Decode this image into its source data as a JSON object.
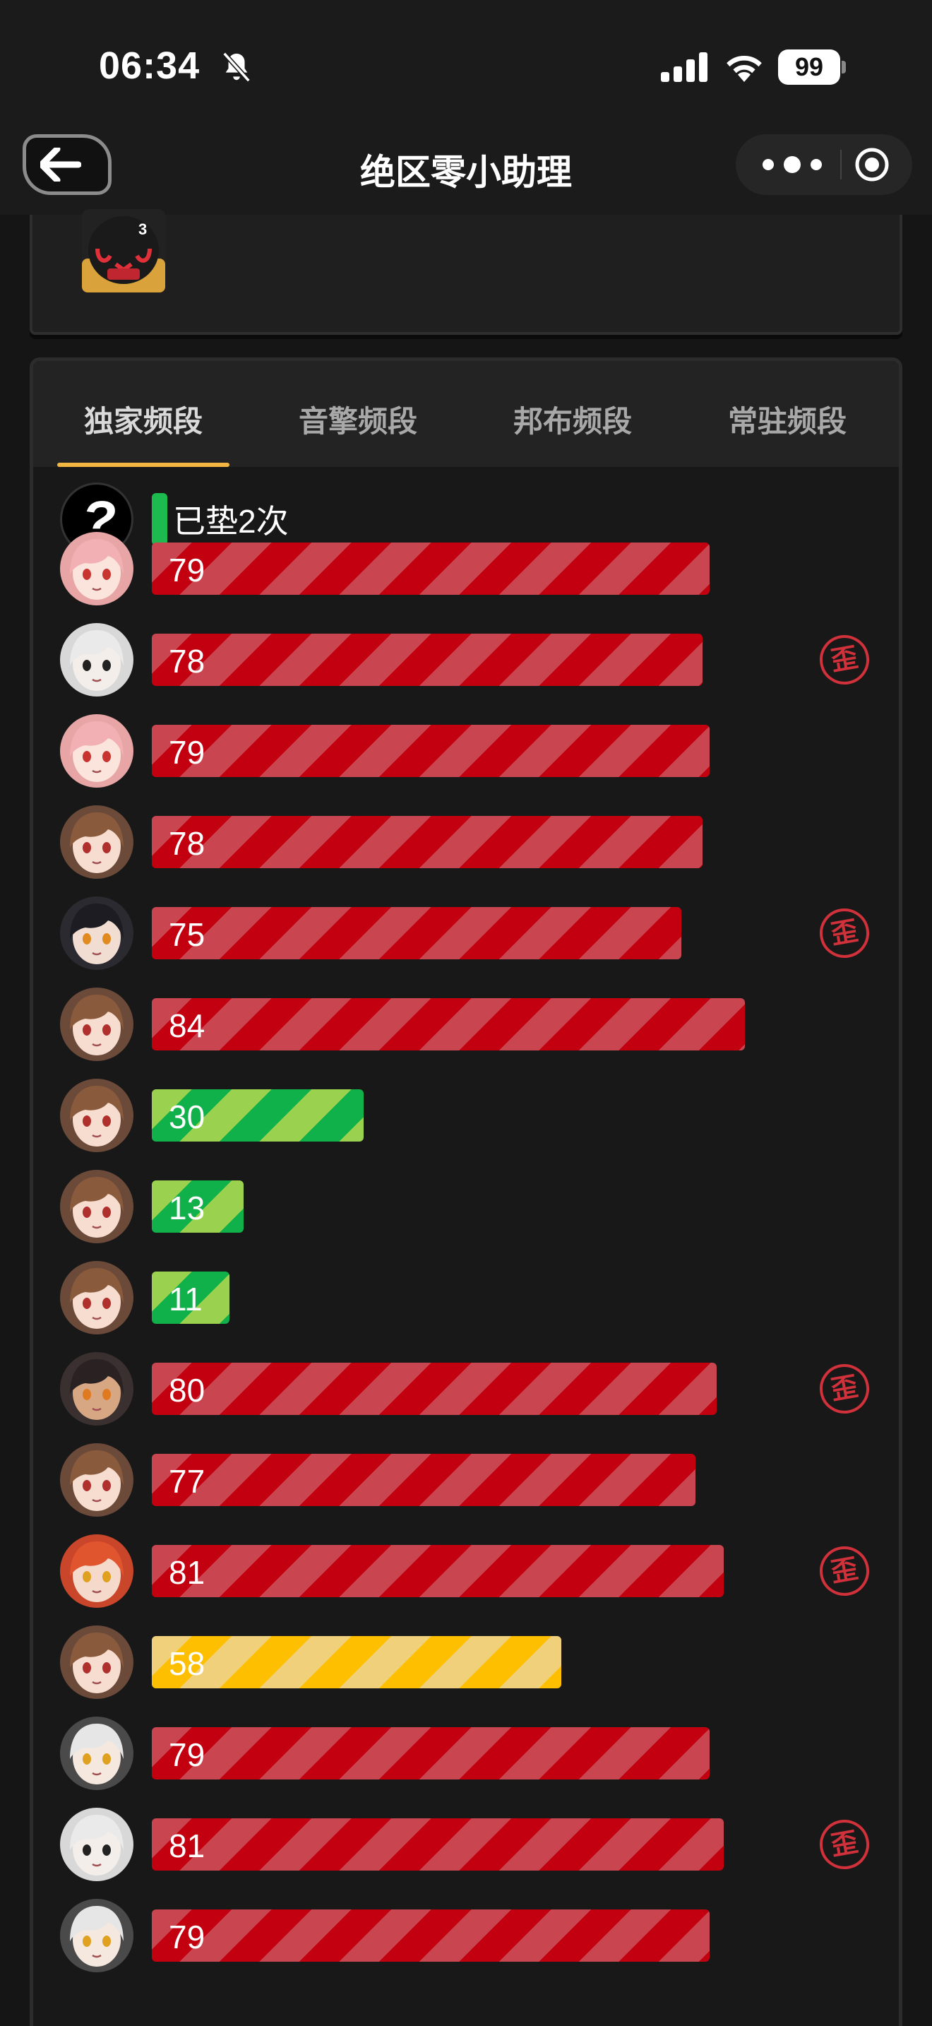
{
  "status_bar": {
    "time": "06:34",
    "battery": "99",
    "bell_icon": "bell-slash-icon",
    "signal_icon": "cellular-signal-icon",
    "wifi_icon": "wifi-icon"
  },
  "navbar": {
    "title": "绝区零小助理",
    "back_icon": "arrow-left-icon",
    "more_icon": "more-dots-icon",
    "close_icon": "target-close-icon"
  },
  "top_card": {
    "badge": "3"
  },
  "tabs": [
    {
      "label": "独家频段",
      "active": true
    },
    {
      "label": "音擎频段",
      "active": false
    },
    {
      "label": "邦布频段",
      "active": false
    },
    {
      "label": "常驻频段",
      "active": false
    }
  ],
  "pity": {
    "text": "已垫2次"
  },
  "pulls": [
    {
      "value": "79",
      "color": "red",
      "width": 0.79,
      "off_banner": false,
      "avatar": "pink"
    },
    {
      "value": "78",
      "color": "red",
      "width": 0.78,
      "off_banner": true,
      "avatar": "white"
    },
    {
      "value": "79",
      "color": "red",
      "width": 0.79,
      "off_banner": false,
      "avatar": "pink"
    },
    {
      "value": "78",
      "color": "red",
      "width": 0.78,
      "off_banner": false,
      "avatar": "brown"
    },
    {
      "value": "75",
      "color": "red",
      "width": 0.75,
      "off_banner": true,
      "avatar": "dark"
    },
    {
      "value": "84",
      "color": "red",
      "width": 0.84,
      "off_banner": false,
      "avatar": "brown"
    },
    {
      "value": "30",
      "color": "green",
      "width": 0.3,
      "off_banner": false,
      "avatar": "brown"
    },
    {
      "value": "13",
      "color": "green",
      "width": 0.13,
      "off_banner": false,
      "avatar": "brown"
    },
    {
      "value": "11",
      "color": "green",
      "width": 0.11,
      "off_banner": false,
      "avatar": "brown"
    },
    {
      "value": "80",
      "color": "red",
      "width": 0.8,
      "off_banner": true,
      "avatar": "tan"
    },
    {
      "value": "77",
      "color": "red",
      "width": 0.77,
      "off_banner": false,
      "avatar": "brown"
    },
    {
      "value": "81",
      "color": "red",
      "width": 0.81,
      "off_banner": true,
      "avatar": "redhair"
    },
    {
      "value": "58",
      "color": "gold",
      "width": 0.58,
      "off_banner": false,
      "avatar": "brown"
    },
    {
      "value": "79",
      "color": "red",
      "width": 0.79,
      "off_banner": false,
      "avatar": "silver"
    },
    {
      "value": "81",
      "color": "red",
      "width": 0.81,
      "off_banner": true,
      "avatar": "white"
    },
    {
      "value": "79",
      "color": "red",
      "width": 0.79,
      "off_banner": false,
      "avatar": "silver"
    }
  ],
  "off_banner_label": "歪",
  "colors": {
    "red": "#c30010",
    "green": "#10b04a",
    "gold": "#fdbf00",
    "accent": "#f2b643",
    "badge": "#d0313a"
  }
}
